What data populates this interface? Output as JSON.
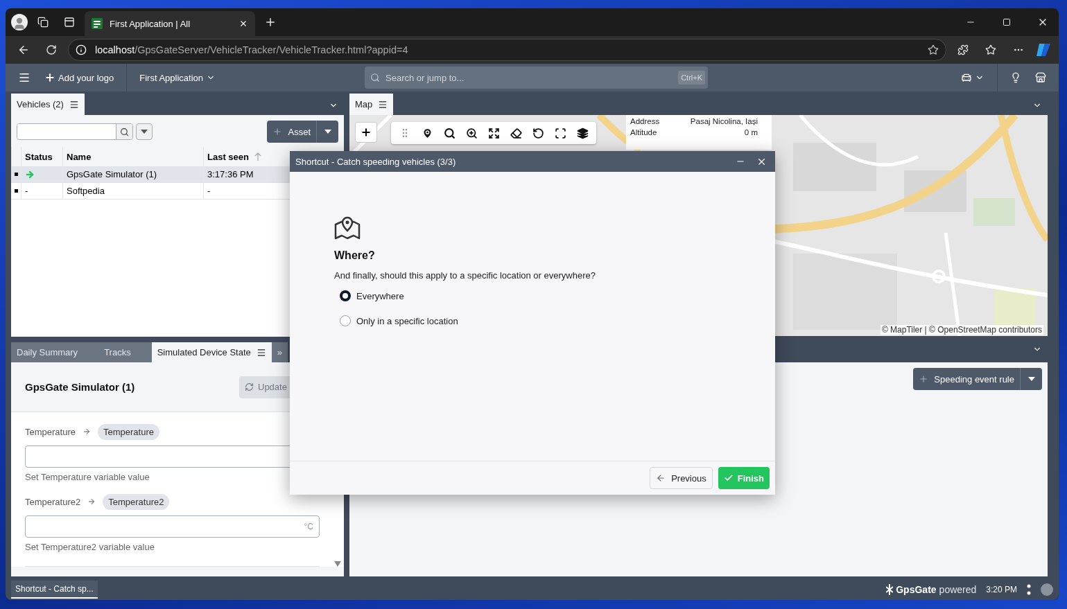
{
  "browser": {
    "tab_title": "First Application | All",
    "url_host": "localhost",
    "url_path": "/GpsGateServer/VehicleTracker/VehicleTracker.html?appid=4"
  },
  "header": {
    "logo_button": "Add your logo",
    "app_menu": "First Application",
    "search": {
      "placeholder": "Search or jump to...",
      "shortcut": "Ctrl+K"
    }
  },
  "vehicles_panel": {
    "tab": "Vehicles (2)",
    "asset_button": "Asset",
    "columns": [
      "Status",
      "Name",
      "Last seen"
    ],
    "rows": [
      {
        "kind": "moving",
        "name": "GpsGate Simulator (1)",
        "last_seen": "3:17:36 PM",
        "selected": true
      },
      {
        "kind": "text",
        "status": "-",
        "name": "Softpedia",
        "last_seen": "-",
        "selected": false
      }
    ]
  },
  "map_panel": {
    "tab": "Map",
    "info": [
      {
        "label": "Address",
        "value": "Pasaj Nicolina, Iași"
      },
      {
        "label": "Altitude",
        "value": "0 m"
      }
    ],
    "attribution": "© MapTiler | © OpenStreetMap contributors"
  },
  "bottom_tabs": [
    {
      "label": "Daily Summary",
      "selected": false
    },
    {
      "label": "Tracks",
      "selected": false
    },
    {
      "label": "Simulated Device State",
      "selected": true
    }
  ],
  "more_tabs": "»",
  "device_state": {
    "title": "GpsGate Simulator (1)",
    "update_button": {
      "label": "Update",
      "disabled": true
    },
    "variables": [
      {
        "name": "Temperature",
        "tag": "Temperature",
        "hint": "Set Temperature variable value"
      },
      {
        "name": "Temperature2",
        "tag": "Temperature2",
        "unit": "°C",
        "hint": "Set Temperature2 variable value"
      }
    ]
  },
  "rules_panel": {
    "add_button": "Speeding event rule"
  },
  "dialog": {
    "title": "Shortcut - Catch speeding vehicles (3/3)",
    "heading": "Where?",
    "question": "And finally, should this apply to a specific location or everywhere?",
    "options": [
      {
        "label": "Everywhere",
        "selected": true
      },
      {
        "label": "Only in a specific location",
        "selected": false
      }
    ],
    "previous": "Previous",
    "finish": "Finish"
  },
  "footer": {
    "task": "Shortcut - Catch sp...",
    "brand": "GpsGate",
    "brand_suffix": "powered",
    "time": "3:20 PM"
  }
}
